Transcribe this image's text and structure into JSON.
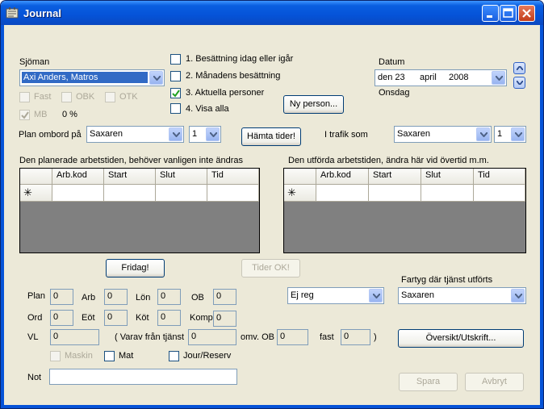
{
  "window": {
    "title": "Journal"
  },
  "sjoman": {
    "label": "Sjöman",
    "value": "Axi Anders, Matros"
  },
  "flags": {
    "fast": "Fast",
    "obk": "OBK",
    "otk": "OTK",
    "mb": "MB",
    "percent": "0 %"
  },
  "filters": {
    "opt1": "1. Besättning idag eller igår",
    "opt2": "2. Månadens besättning",
    "opt3": "3. Aktuella personer",
    "opt4": "4. Visa alla",
    "opt3_checked": true
  },
  "ny_person": "Ny person...",
  "datum": {
    "label": "Datum",
    "day": "den 23",
    "month": "april",
    "year": "2008",
    "weekday": "Onsdag"
  },
  "plan_ombord": {
    "label": "Plan ombord på",
    "ship": "Saxaren",
    "num": "1"
  },
  "hamta": "Hämta tider!",
  "i_trafik": {
    "label": "I trafik som",
    "ship": "Saxaren",
    "num": "1"
  },
  "planned": {
    "caption": "Den planerade arbetstiden, behöver vanligen inte ändras",
    "columns": [
      "Arb.kod",
      "Start",
      "Slut",
      "Tid"
    ],
    "new_row_marker": "✳"
  },
  "performed": {
    "caption": "Den utförda arbetstiden, ändra här vid övertid m.m.",
    "columns": [
      "Arb.kod",
      "Start",
      "Slut",
      "Tid"
    ],
    "new_row_marker": "✳"
  },
  "fridag": "Fridag!",
  "tider_ok": "Tider OK!",
  "fartyg": {
    "label": "Fartyg där tjänst utförts",
    "value": "Saxaren"
  },
  "ejreg": "Ej reg",
  "fields": {
    "plan": {
      "label": "Plan",
      "value": "0"
    },
    "arb": {
      "label": "Arb",
      "value": "0"
    },
    "lon": {
      "label": "Lön",
      "value": "0"
    },
    "ob": {
      "label": "OB",
      "value": "0"
    },
    "ord": {
      "label": "Ord",
      "value": "0"
    },
    "eot": {
      "label": "Eöt",
      "value": "0"
    },
    "kot": {
      "label": "Köt",
      "value": "0"
    },
    "komp": {
      "label": "Komp",
      "value": "0"
    },
    "vl": {
      "label": "VL",
      "value": "0"
    },
    "varav": {
      "label": "( Varav från tjänst",
      "value": "0"
    },
    "omv_ob": {
      "label": "omv. OB",
      "value": "0"
    },
    "fast": {
      "label": "fast",
      "value": "0"
    },
    "close_paren": ")"
  },
  "checks": {
    "maskin": "Maskin",
    "mat": "Mat",
    "jour": "Jour/Reserv"
  },
  "oversikt": "Översikt/Utskrift...",
  "not": {
    "label": "Not",
    "value": ""
  },
  "spara": "Spara",
  "avbryt": "Avbryt"
}
